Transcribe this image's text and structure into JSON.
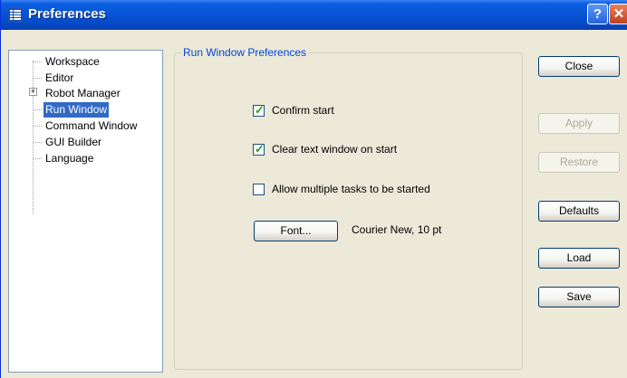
{
  "window": {
    "title": "Preferences",
    "help_label": "?",
    "close_label": "✕"
  },
  "tree": {
    "items": [
      {
        "label": "Workspace"
      },
      {
        "label": "Editor"
      },
      {
        "label": "Robot Manager",
        "expander": "+"
      },
      {
        "label": "Run Window",
        "selected": true
      },
      {
        "label": "Command Window"
      },
      {
        "label": "GUI Builder"
      },
      {
        "label": "Language"
      }
    ]
  },
  "group": {
    "label": "Run Window Preferences",
    "options": [
      {
        "label": "Confirm start",
        "checked": true
      },
      {
        "label": "Clear text window on start",
        "checked": true
      },
      {
        "label": "Allow multiple tasks to be started",
        "checked": false
      }
    ],
    "font_button": "Font...",
    "font_value": "Courier New, 10 pt"
  },
  "buttons": {
    "close": "Close",
    "apply": "Apply",
    "restore": "Restore",
    "defaults": "Defaults",
    "load": "Load",
    "save": "Save"
  },
  "colors": {
    "titlebar": "#0653d4",
    "selection": "#316ac5",
    "group_label": "#0046d5",
    "checkmark": "#21a121"
  }
}
